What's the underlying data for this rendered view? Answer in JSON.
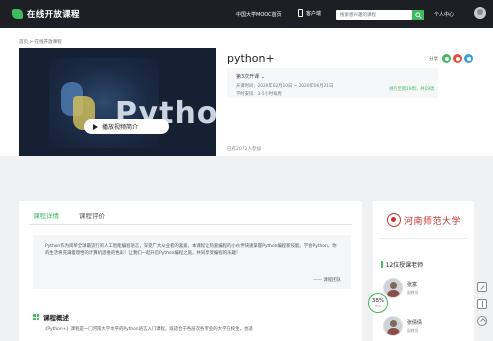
{
  "topbar": {
    "brand": "在线开放课程",
    "nav_mooc": "中国大学MOOC首页",
    "nav_app": "客户端",
    "search_placeholder": "搜索感兴趣的课程",
    "nav_user": "个人中心"
  },
  "breadcrumb": "首页 > 在线开放课程",
  "video": {
    "play_label": "播放视频简介",
    "overlay_text": "Python+"
  },
  "course": {
    "title": "python+",
    "share_label": "分享",
    "term_select": "第3次开课",
    "dates": "开课时间：2020年02月10日 ~ 2020年06月21日",
    "hours": "学时安排：3-5小时每周",
    "term_link": "进行至第19周，共19周",
    "enrolled": "已有2072人参加"
  },
  "share_colors": [
    "#3dbb5d",
    "#e0503f",
    "#3c9ee0"
  ],
  "tabs": [
    {
      "label": "课程详情",
      "active": true
    },
    {
      "label": "课程评价",
      "active": false
    }
  ],
  "intro": {
    "text": "Python作为简单全球最流行的人工智能编程语言，深受广大从业者的喜爱。本课程让热爱编程的小伙伴快速掌握Python编程新技能。学会Python，你的生活将充满着理性的计算机思维的色彩！让我们一起开启Python编程之旅，共同享受编程的乐趣！",
    "sign": "—— 课程团队"
  },
  "overview": {
    "title": "课程概述",
    "text": "《Python+》课程是一门河南大学水平的Python语言入门课程，既适合于各层次各专业的大学在校生，也适"
  },
  "side": {
    "school": "河南师范大学",
    "teachers_title": "12位授课老师",
    "teachers": [
      {
        "name": "张富",
        "role": "副教授"
      },
      {
        "name": "张倩倩",
        "role": "副教授"
      }
    ]
  },
  "progress": {
    "value": "38%",
    "sub": "0K/s"
  }
}
